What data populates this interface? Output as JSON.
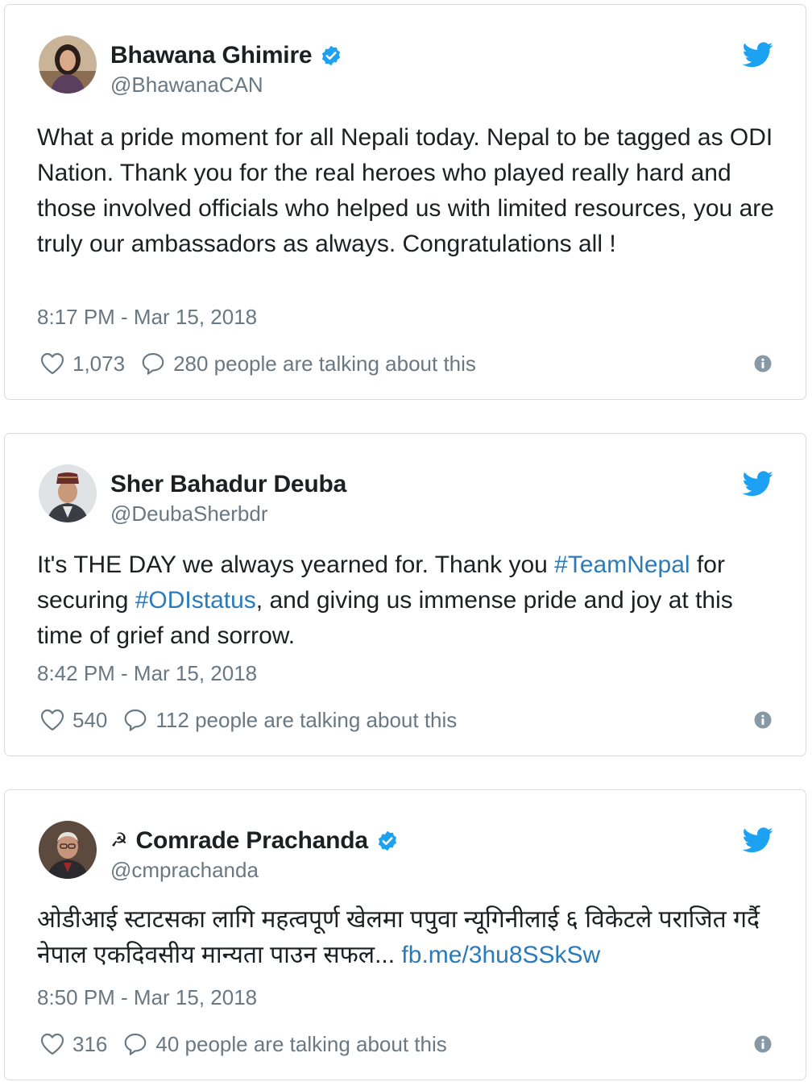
{
  "colors": {
    "link": "#2b7bb9",
    "verified": "#1da1f2",
    "twitter_bird": "#1da1f2",
    "muted_text": "#697882",
    "primary_text": "#1c2022",
    "card_border": "#d6dce1"
  },
  "tweets": [
    {
      "display_name": "Bhawana Ghimire",
      "handle": "@BhawanaCAN",
      "verified": true,
      "name_prefix_icon": null,
      "avatar": "avatar-woman-portrait",
      "text": "What a pride moment for all Nepali today. Nepal to be tagged as ODI  Nation. Thank you for the real heroes who played really hard and those involved officials who helped us with limited resources, you are truly our ambassadors as always. Congratulations all !",
      "timestamp": "8:17 PM - Mar 15, 2018",
      "likes": "1,073",
      "talking": "280 people are talking about this"
    },
    {
      "display_name": "Sher Bahadur Deuba",
      "handle": "@DeubaSherbdr",
      "verified": false,
      "name_prefix_icon": null,
      "avatar": "avatar-man-topi",
      "text_parts": {
        "t1": "It's THE DAY we always yearned for. Thank you ",
        "h1": "#TeamNepal",
        "t2": " for securing ",
        "h2": "#ODIstatus",
        "t3": ", and giving us immense pride and joy at this time of grief and sorrow."
      },
      "timestamp": "8:42 PM - Mar 15, 2018",
      "likes": "540",
      "talking": "112 people are talking about this"
    },
    {
      "display_name": "Comrade Prachanda",
      "handle": "@cmprachanda",
      "verified": true,
      "name_prefix_icon": "☭",
      "avatar": "avatar-man-glasses",
      "text_parts": {
        "t1": "ओडीआई स्टाटसका लागि महत्वपूर्ण खेलमा पपुवा न्यूगिनीलाई ६ विकेटले पराजित गर्दै नेपाल एकदिवसीय मान्यता पाउन सफल... ",
        "link": "fb.me/3hu8SSkSw"
      },
      "timestamp": "8:50 PM - Mar 15, 2018",
      "likes": "316",
      "talking": "40 people are talking about this"
    }
  ],
  "icons": {
    "like": "heart-outline-icon",
    "reply": "speech-bubble-icon",
    "info": "info-circle-icon",
    "brand": "twitter-bird-icon",
    "verified": "verified-badge-icon"
  }
}
